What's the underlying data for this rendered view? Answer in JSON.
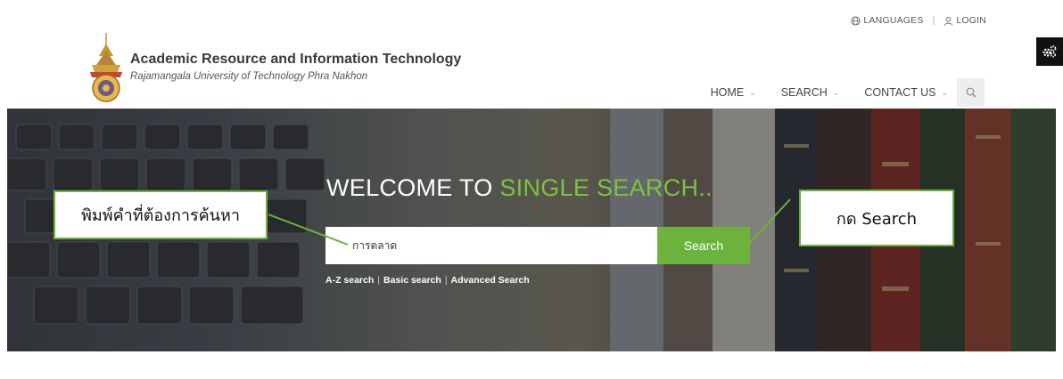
{
  "util": {
    "languages": "LANGUAGES",
    "login": "LOGIN"
  },
  "brand": {
    "title": "Academic Resource and Information Technology",
    "subtitle": "Rajamangala University of Technology Phra Nakhon"
  },
  "nav": {
    "items": [
      "HOME",
      "SEARCH",
      "CONTACT US"
    ]
  },
  "hero": {
    "welcome_prefix": "WELCOME TO",
    "welcome_accent": "SINGLE SEARCH..",
    "search_value": "การตลาด",
    "search_button": "Search",
    "links": [
      "A-Z search",
      "Basic search",
      "Advanced Search"
    ]
  },
  "callouts": {
    "left": "พิมพ์คำที่ต้องการค้นหา",
    "right": "กด Search"
  },
  "colors": {
    "accent": "#6cb33e",
    "callout_border": "#6cb33e",
    "dark": "#111111"
  }
}
